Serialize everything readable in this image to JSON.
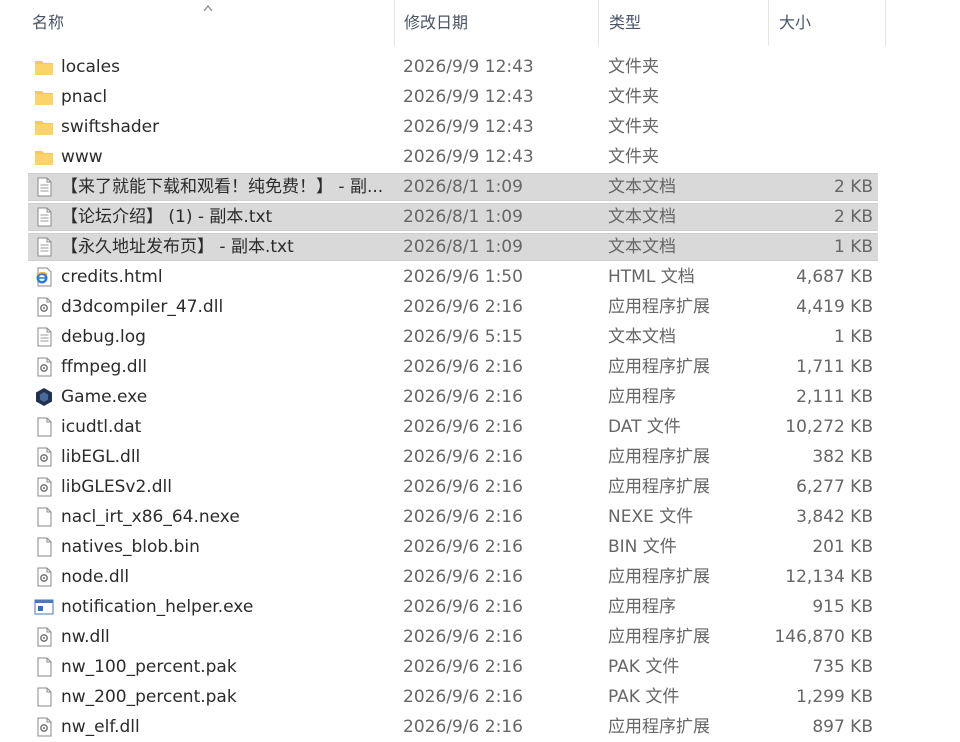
{
  "header": {
    "name": "名称",
    "date": "修改日期",
    "type": "类型",
    "size": "大小"
  },
  "files": [
    {
      "name": "locales",
      "date": "2026/9/9 12:43",
      "type": "文件夹",
      "size": "",
      "icon": "folder-icon",
      "selected": false
    },
    {
      "name": "pnacl",
      "date": "2026/9/9 12:43",
      "type": "文件夹",
      "size": "",
      "icon": "folder-icon",
      "selected": false
    },
    {
      "name": "swiftshader",
      "date": "2026/9/9 12:43",
      "type": "文件夹",
      "size": "",
      "icon": "folder-icon",
      "selected": false
    },
    {
      "name": "www",
      "date": "2026/9/9 12:43",
      "type": "文件夹",
      "size": "",
      "icon": "folder-icon",
      "selected": false
    },
    {
      "name": "【来了就能下载和观看！纯免费！】 - 副...",
      "date": "2026/8/1 1:09",
      "type": "文本文档",
      "size": "2 KB",
      "icon": "text-file-icon",
      "selected": true
    },
    {
      "name": "【论坛介绍】 (1) - 副本.txt",
      "date": "2026/8/1 1:09",
      "type": "文本文档",
      "size": "2 KB",
      "icon": "text-file-icon",
      "selected": true
    },
    {
      "name": "【永久地址发布页】 - 副本.txt",
      "date": "2026/8/1 1:09",
      "type": "文本文档",
      "size": "1 KB",
      "icon": "text-file-icon",
      "selected": true
    },
    {
      "name": "credits.html",
      "date": "2026/9/6 1:50",
      "type": "HTML 文档",
      "size": "4,687 KB",
      "icon": "html-file-icon",
      "selected": false
    },
    {
      "name": "d3dcompiler_47.dll",
      "date": "2026/9/6 2:16",
      "type": "应用程序扩展",
      "size": "4,419 KB",
      "icon": "dll-file-icon",
      "selected": false
    },
    {
      "name": "debug.log",
      "date": "2026/9/6 5:15",
      "type": "文本文档",
      "size": "1 KB",
      "icon": "text-file-icon",
      "selected": false
    },
    {
      "name": "ffmpeg.dll",
      "date": "2026/9/6 2:16",
      "type": "应用程序扩展",
      "size": "1,711 KB",
      "icon": "dll-file-icon",
      "selected": false
    },
    {
      "name": "Game.exe",
      "date": "2026/9/6 2:16",
      "type": "应用程序",
      "size": "2,111 KB",
      "icon": "game-exe-icon",
      "selected": false
    },
    {
      "name": "icudtl.dat",
      "date": "2026/9/6 2:16",
      "type": "DAT 文件",
      "size": "10,272 KB",
      "icon": "blank-file-icon",
      "selected": false
    },
    {
      "name": "libEGL.dll",
      "date": "2026/9/6 2:16",
      "type": "应用程序扩展",
      "size": "382 KB",
      "icon": "dll-file-icon",
      "selected": false
    },
    {
      "name": "libGLESv2.dll",
      "date": "2026/9/6 2:16",
      "type": "应用程序扩展",
      "size": "6,277 KB",
      "icon": "dll-file-icon",
      "selected": false
    },
    {
      "name": "nacl_irt_x86_64.nexe",
      "date": "2026/9/6 2:16",
      "type": "NEXE 文件",
      "size": "3,842 KB",
      "icon": "blank-file-icon",
      "selected": false
    },
    {
      "name": "natives_blob.bin",
      "date": "2026/9/6 2:16",
      "type": "BIN 文件",
      "size": "201 KB",
      "icon": "blank-file-icon",
      "selected": false
    },
    {
      "name": "node.dll",
      "date": "2026/9/6 2:16",
      "type": "应用程序扩展",
      "size": "12,134 KB",
      "icon": "dll-file-icon",
      "selected": false
    },
    {
      "name": "notification_helper.exe",
      "date": "2026/9/6 2:16",
      "type": "应用程序",
      "size": "915 KB",
      "icon": "exe-window-icon",
      "selected": false
    },
    {
      "name": "nw.dll",
      "date": "2026/9/6 2:16",
      "type": "应用程序扩展",
      "size": "146,870 KB",
      "icon": "dll-file-icon",
      "selected": false
    },
    {
      "name": "nw_100_percent.pak",
      "date": "2026/9/6 2:16",
      "type": "PAK 文件",
      "size": "735 KB",
      "icon": "blank-file-icon",
      "selected": false
    },
    {
      "name": "nw_200_percent.pak",
      "date": "2026/9/6 2:16",
      "type": "PAK 文件",
      "size": "1,299 KB",
      "icon": "blank-file-icon",
      "selected": false
    },
    {
      "name": "nw_elf.dll",
      "date": "2026/9/6 2:16",
      "type": "应用程序扩展",
      "size": "897 KB",
      "icon": "dll-file-icon",
      "selected": false
    }
  ]
}
